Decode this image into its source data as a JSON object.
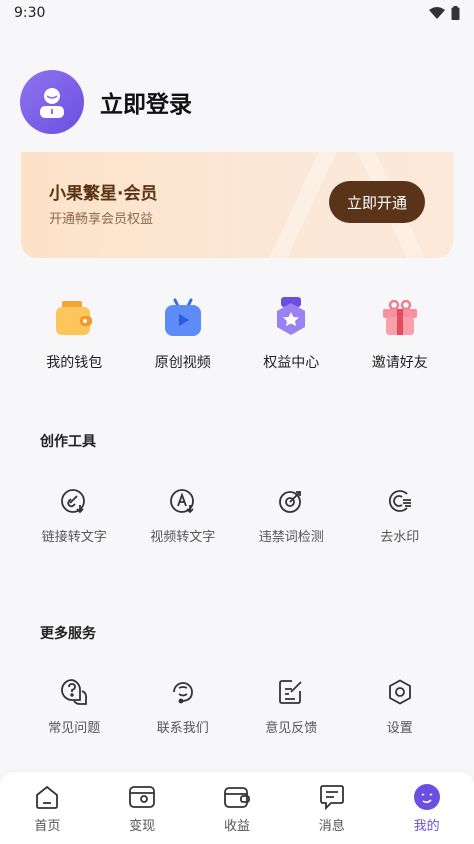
{
  "status_bar": {
    "time": "9:30"
  },
  "profile": {
    "login_label": "立即登录"
  },
  "vip": {
    "title": "小果繁星·会员",
    "subtitle": "开通畅享会员权益",
    "button": "立即开通"
  },
  "quick": [
    {
      "label": "我的钱包",
      "icon": "wallet-icon"
    },
    {
      "label": "原创视频",
      "icon": "video-icon"
    },
    {
      "label": "权益中心",
      "icon": "benefits-icon"
    },
    {
      "label": "邀请好友",
      "icon": "gift-icon"
    }
  ],
  "tools": {
    "title": "创作工具",
    "items": [
      {
        "label": "链接转文字",
        "icon": "link-text-icon"
      },
      {
        "label": "视频转文字",
        "icon": "video-text-icon"
      },
      {
        "label": "违禁词检测",
        "icon": "target-icon"
      },
      {
        "label": "去水印",
        "icon": "watermark-icon"
      }
    ]
  },
  "services": {
    "title": "更多服务",
    "items": [
      {
        "label": "常见问题",
        "icon": "faq-icon"
      },
      {
        "label": "联系我们",
        "icon": "support-icon"
      },
      {
        "label": "意见反馈",
        "icon": "feedback-icon"
      },
      {
        "label": "设置",
        "icon": "settings-icon"
      }
    ]
  },
  "tabbar": {
    "items": [
      {
        "label": "首页",
        "icon": "home-icon"
      },
      {
        "label": "变现",
        "icon": "monetize-icon"
      },
      {
        "label": "收益",
        "icon": "earnings-icon"
      },
      {
        "label": "消息",
        "icon": "message-icon"
      },
      {
        "label": "我的",
        "icon": "profile-icon"
      }
    ],
    "active": "我的"
  },
  "colors": {
    "accent": "#6a4fe0",
    "vip_button": "#5a3418",
    "vip_bg": "#fde2c8"
  }
}
